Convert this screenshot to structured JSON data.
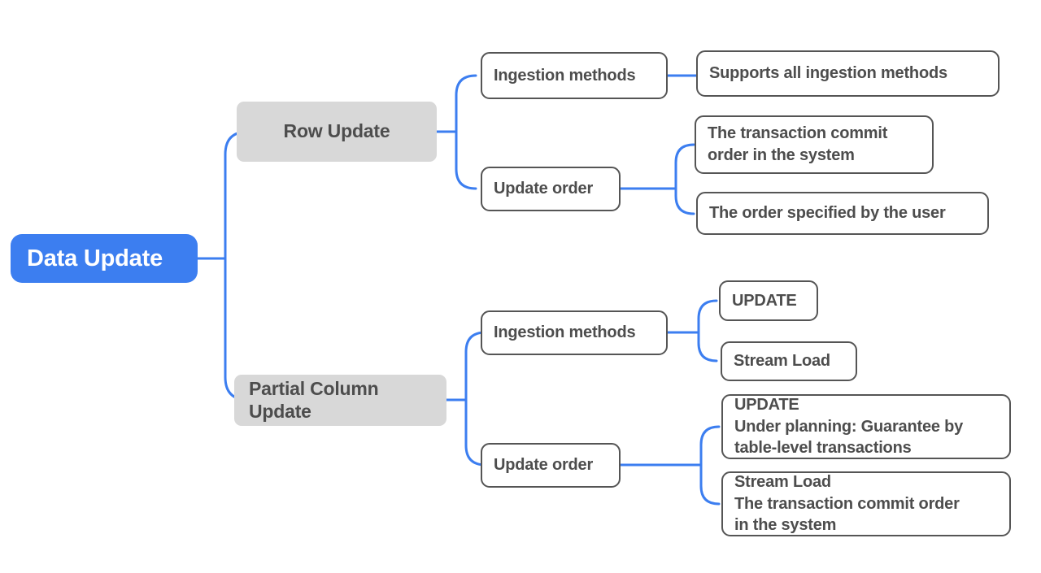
{
  "diagram": {
    "type": "mindmap",
    "title": "Data Update",
    "colors": {
      "root_fill": "#3c7ef0",
      "root_text": "#ffffff",
      "branch_fill": "#d8d8d8",
      "branch_text": "#4d4d4d",
      "leaf_fill": "#ffffff",
      "leaf_border": "#555555",
      "leaf_text": "#4d4d4d",
      "connector": "#3c7ef0",
      "background": "#ffffff"
    }
  },
  "root": {
    "label": "Data Update"
  },
  "branches": [
    {
      "label": "Row Update",
      "children": [
        {
          "label": "Ingestion methods",
          "children": [
            {
              "label": "Supports all ingestion methods"
            }
          ]
        },
        {
          "label": "Update order",
          "children": [
            {
              "label": "The transaction commit\norder in the system"
            },
            {
              "label": "The order specified by the user"
            }
          ]
        }
      ]
    },
    {
      "label": "Partial Column Update",
      "children": [
        {
          "label": "Ingestion methods",
          "children": [
            {
              "label": "UPDATE"
            },
            {
              "label": "Stream Load"
            }
          ]
        },
        {
          "label": "Update order",
          "children": [
            {
              "label": "UPDATE\nUnder planning: Guarantee by\ntable-level transactions"
            },
            {
              "label": "Stream Load\nThe transaction commit order\nin the system"
            }
          ]
        }
      ]
    }
  ]
}
